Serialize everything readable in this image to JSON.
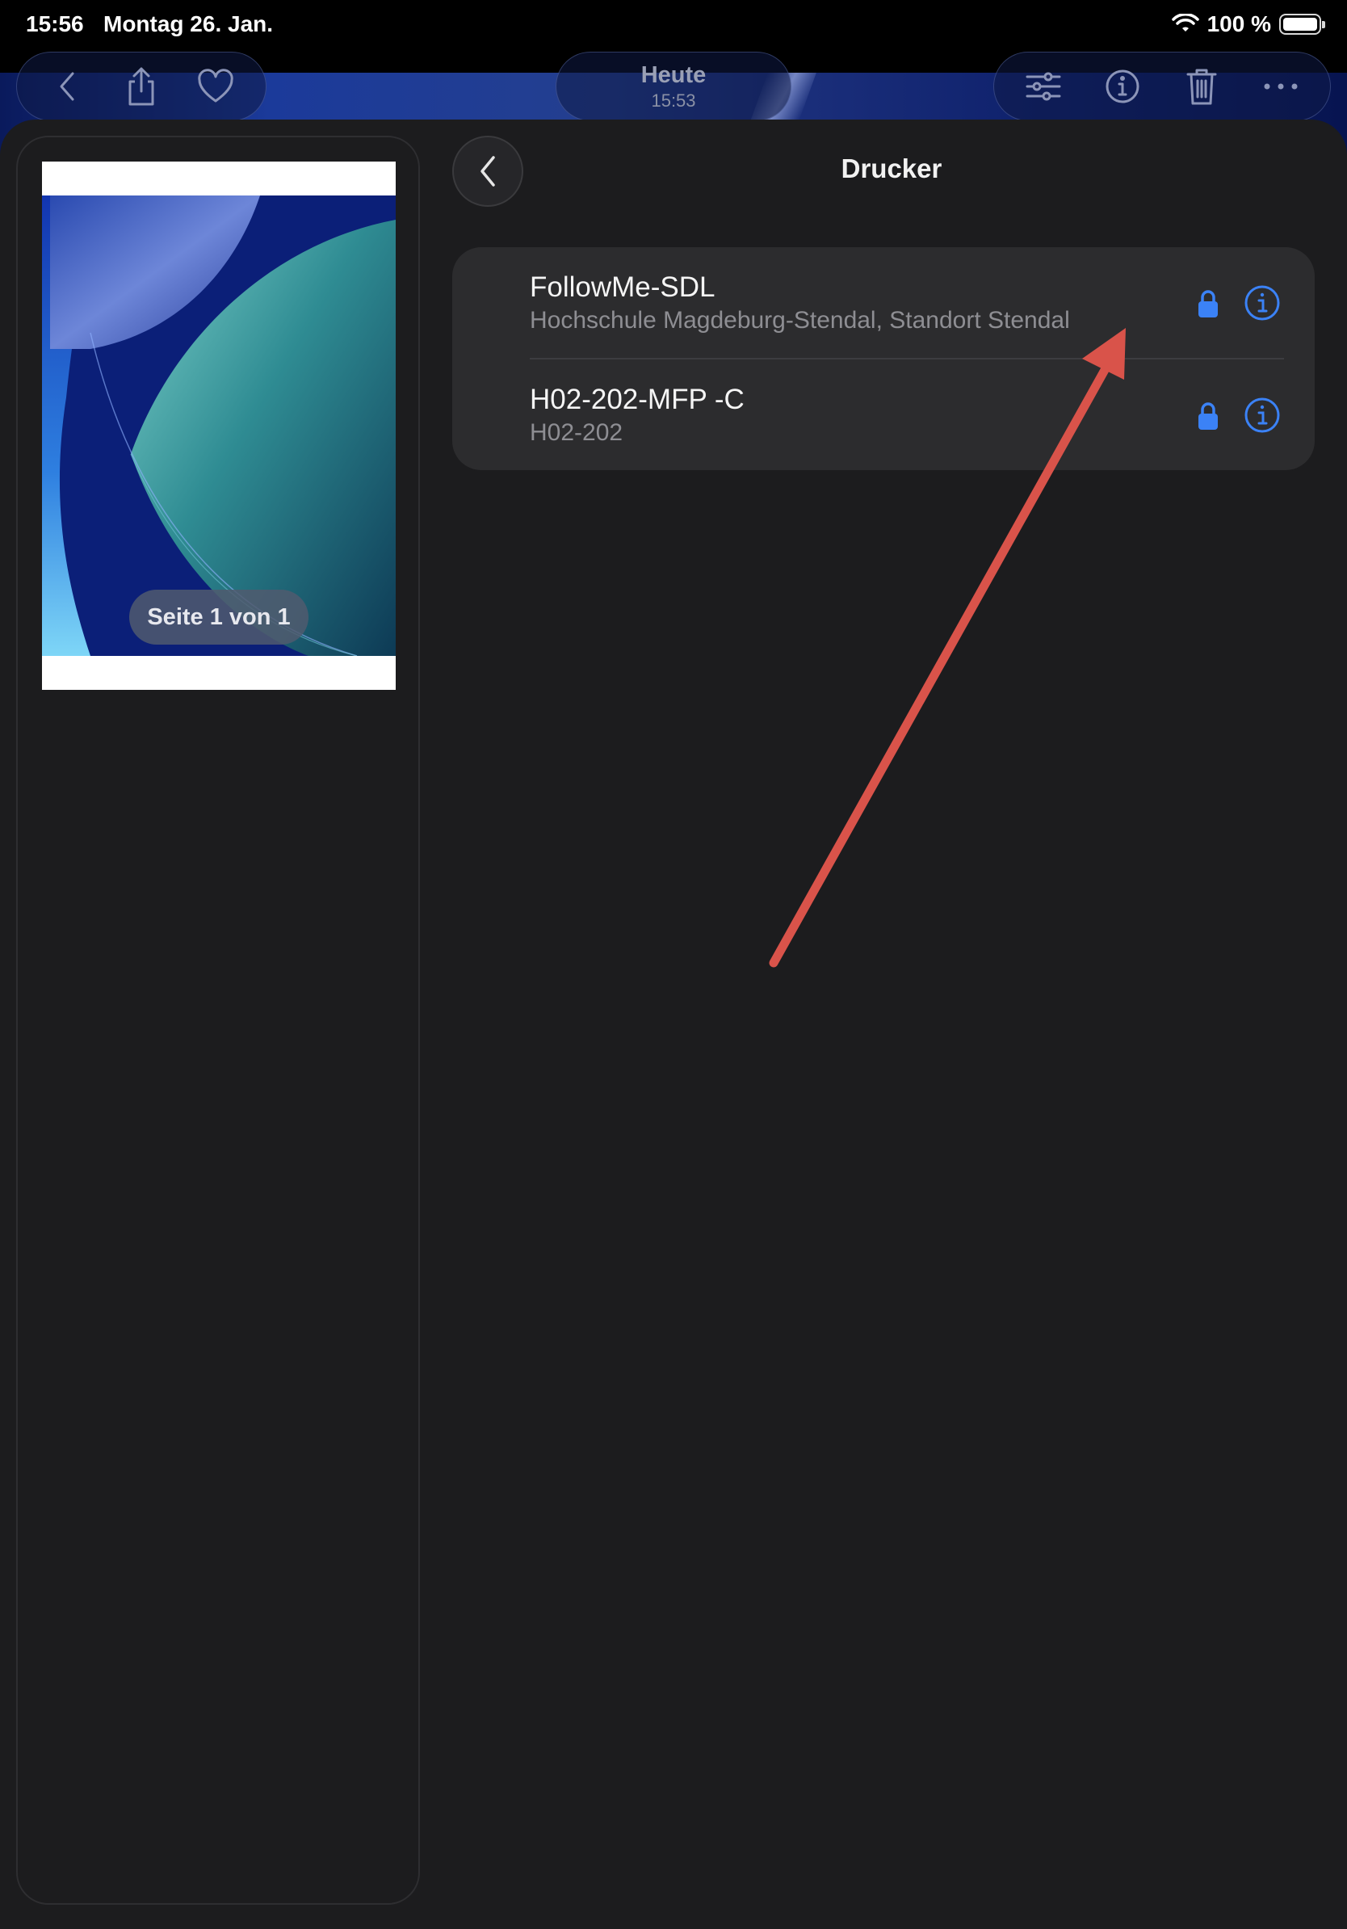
{
  "status_bar": {
    "time": "15:56",
    "date": "Montag 26. Jan.",
    "battery": "100 %",
    "icons": [
      "wifi-icon",
      "battery-icon"
    ]
  },
  "toolbar": {
    "left_icons": [
      "back-icon",
      "share-icon",
      "heart-icon"
    ],
    "center_title": "Heute",
    "center_subtitle": "15:53",
    "right_icons": [
      "adjust-icon",
      "info-icon",
      "trash-icon",
      "more-icon"
    ]
  },
  "preview": {
    "page_indicator": "Seite 1 von 1"
  },
  "printer_pane": {
    "title": "Drucker",
    "back_icon": "chevron-left-icon",
    "printers": [
      {
        "name": "FollowMe-SDL",
        "location": "Hochschule Magdeburg-Stendal, Standort Stendal",
        "locked": true
      },
      {
        "name": "H02-202-MFP -C",
        "location": "H02-202",
        "locked": true
      }
    ]
  },
  "colors": {
    "accent_blue": "#3b82f6",
    "sheet_bg": "#1c1c1e",
    "row_bg": "#2c2c2e",
    "annotation_arrow": "#d9534a"
  }
}
